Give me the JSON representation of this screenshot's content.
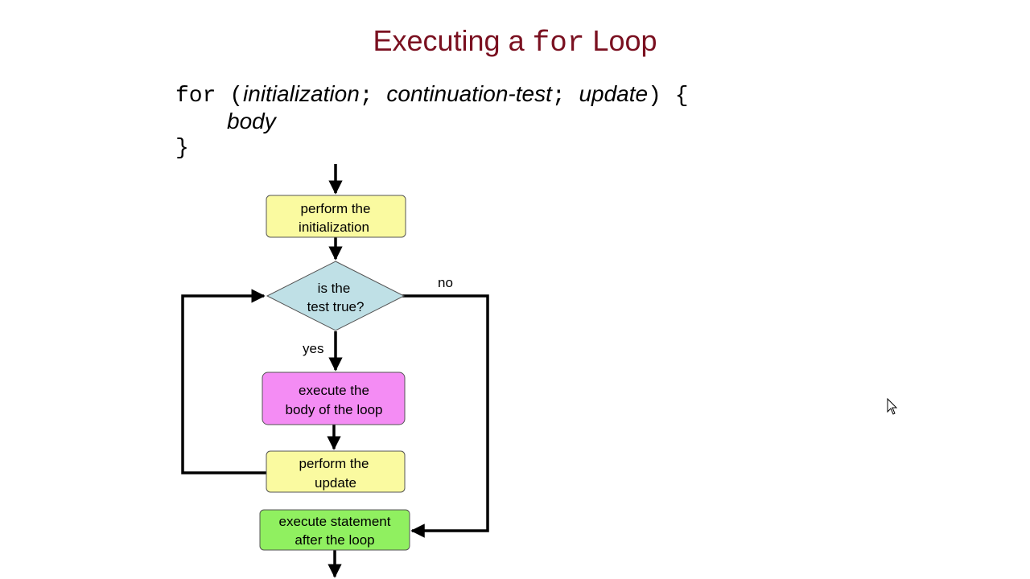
{
  "title": {
    "prefix": "Executing a ",
    "keyword": "for",
    "suffix": " Loop"
  },
  "syntax": {
    "kw_for": "for",
    "open_paren": " (",
    "initialization": "initialization",
    "sep1": "; ",
    "continuation_test": "continuation-test",
    "sep2": "; ",
    "update": "update",
    "close": ") {",
    "body": "body",
    "closing_brace": "}"
  },
  "flowchart": {
    "init_line1": "perform the",
    "init_line2": "initialization",
    "test_line1": "is the",
    "test_line2": "test true?",
    "yes_label": "yes",
    "no_label": "no",
    "body_line1": "execute the",
    "body_line2": "body of the loop",
    "update_line1": "perform the",
    "update_line2": "update",
    "after_line1": "execute statement",
    "after_line2": "after the loop"
  },
  "colors": {
    "title": "#7a1020",
    "init_box": "#fafaa0",
    "test_diamond": "#bfe0e6",
    "body_box": "#f48cf4",
    "update_box": "#fafaa0",
    "after_box": "#90f060"
  }
}
